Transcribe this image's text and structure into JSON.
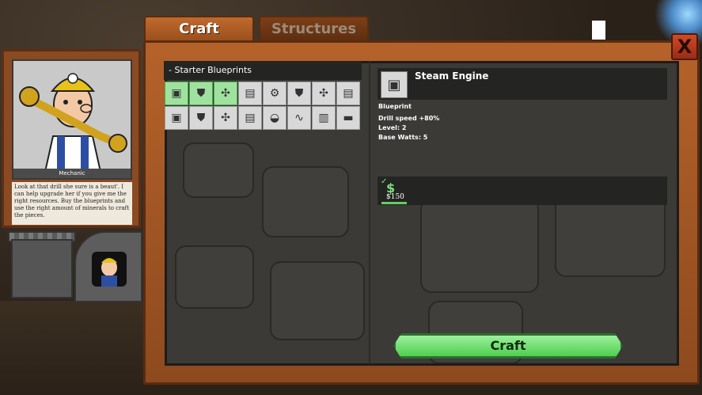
{
  "tabs": [
    {
      "label": "Craft",
      "active": true
    },
    {
      "label": "Structures",
      "active": false
    }
  ],
  "close_label": "X",
  "mechanic": {
    "name": "Mechanic",
    "text": "Look at that drill she sure is a beaut'. I can help upgrade her if you give me the right resources. Buy the blueprints and use the right amount of minerals to craft the pieces."
  },
  "blueprints": {
    "header": "- Starter Blueprints",
    "items": [
      {
        "icon": "engine-icon",
        "glyph": "▣",
        "selected": true
      },
      {
        "icon": "shield-icon",
        "glyph": "⛊",
        "selected": true
      },
      {
        "icon": "fan-icon",
        "glyph": "✣",
        "selected": true
      },
      {
        "icon": "plate-icon",
        "glyph": "▤",
        "selected": false
      },
      {
        "icon": "gear-icon",
        "glyph": "⚙",
        "selected": false
      },
      {
        "icon": "shield-icon",
        "glyph": "⛊",
        "selected": false
      },
      {
        "icon": "fan-icon",
        "glyph": "✣",
        "selected": false
      },
      {
        "icon": "plate-icon",
        "glyph": "▤",
        "selected": false
      },
      {
        "icon": "engine-icon",
        "glyph": "▣",
        "selected": false
      },
      {
        "icon": "shield-icon",
        "glyph": "⛊",
        "selected": false
      },
      {
        "icon": "fan-icon",
        "glyph": "✣",
        "selected": false
      },
      {
        "icon": "plate-icon",
        "glyph": "▤",
        "selected": false
      },
      {
        "icon": "pot-icon",
        "glyph": "◒",
        "selected": false
      },
      {
        "icon": "pipe-icon",
        "glyph": "∿",
        "selected": false
      },
      {
        "icon": "radiator-icon",
        "glyph": "▥",
        "selected": false
      },
      {
        "icon": "cart-icon",
        "glyph": "▬",
        "selected": false
      }
    ]
  },
  "detail": {
    "title": "Steam Engine",
    "icon": "engine-icon",
    "kind": "Blueprint",
    "stats": [
      "Drill speed +80%",
      "Level: 2",
      "Base Watts: 5"
    ]
  },
  "cost": {
    "check": "✓",
    "icon": "cash-icon",
    "amount": "$150",
    "affordable": true
  },
  "craft_button": "Craft"
}
